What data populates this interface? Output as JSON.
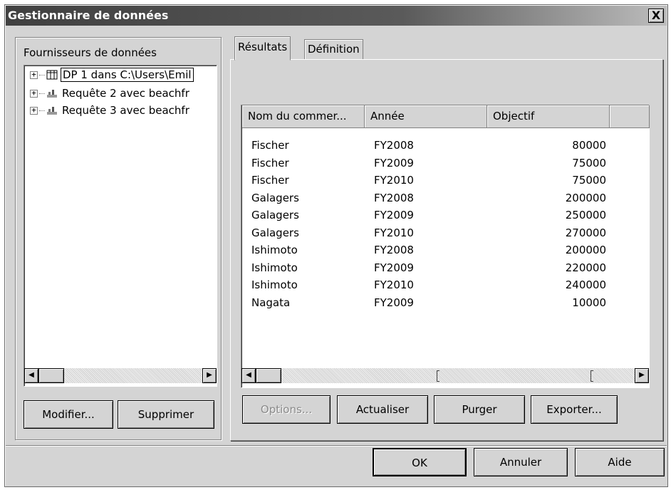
{
  "window": {
    "title": "Gestionnaire de données",
    "close_symbol": "X"
  },
  "providers": {
    "label": "Fournisseurs de données",
    "items": [
      {
        "text": "DP 1 dans C:\\Users\\Emil",
        "icon": "table-icon",
        "selected": true
      },
      {
        "text": "Requête 2 avec beachfr",
        "icon": "query-icon",
        "selected": false
      },
      {
        "text": "Requête 3 avec beachfr",
        "icon": "query-icon",
        "selected": false
      }
    ],
    "expander": "+",
    "modify_label": "Modifier...",
    "delete_label": "Supprimer"
  },
  "tabs": [
    {
      "label": "Résultats",
      "active": true
    },
    {
      "label": "Définition",
      "active": false
    }
  ],
  "results": {
    "columns": [
      "Nom du commer...",
      "Année",
      "Objectif"
    ],
    "rows": [
      [
        "Fischer",
        "FY2008",
        "80000"
      ],
      [
        "Fischer",
        "FY2009",
        "75000"
      ],
      [
        "Fischer",
        "FY2010",
        "75000"
      ],
      [
        "Galagers",
        "FY2008",
        "200000"
      ],
      [
        "Galagers",
        "FY2009",
        "250000"
      ],
      [
        "Galagers",
        "FY2010",
        "270000"
      ],
      [
        "Ishimoto",
        "FY2008",
        "200000"
      ],
      [
        "Ishimoto",
        "FY2009",
        "220000"
      ],
      [
        "Ishimoto",
        "FY2010",
        "240000"
      ],
      [
        "Nagata",
        "FY2009",
        "10000"
      ]
    ],
    "options_label": "Options...",
    "refresh_label": "Actualiser",
    "purge_label": "Purger",
    "export_label": "Exporter..."
  },
  "footer": {
    "ok_label": "OK",
    "cancel_label": "Annuler",
    "help_label": "Aide"
  },
  "scroll": {
    "left_arrow": "◀",
    "right_arrow": "▶"
  }
}
